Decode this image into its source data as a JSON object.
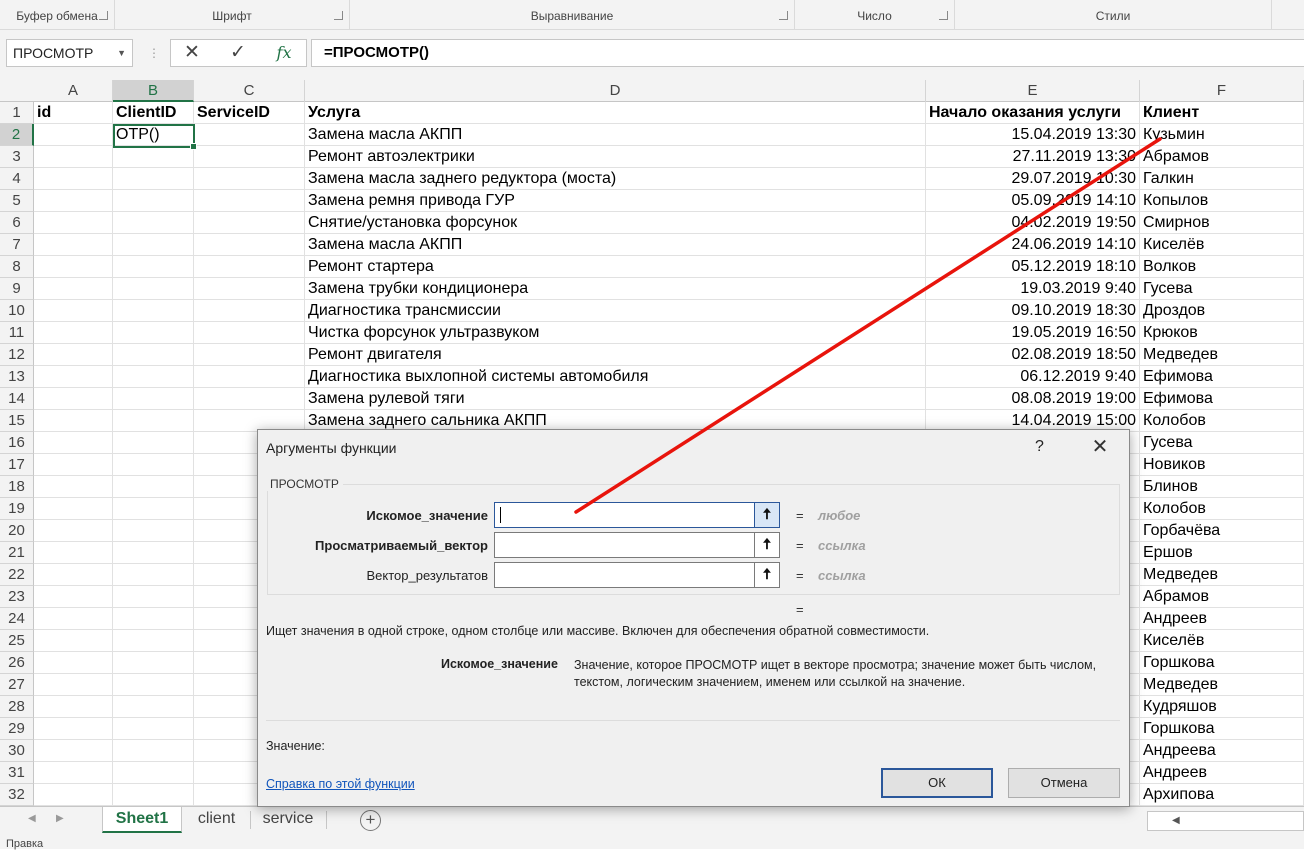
{
  "ribbon": {
    "groups": [
      "Буфер обмена",
      "Шрифт",
      "Выравнивание",
      "Число",
      "Стили"
    ]
  },
  "formula_bar": {
    "name_box": "ПРОСМОТР",
    "formula": "=ПРОСМОТР()",
    "fx": "fx"
  },
  "columns": [
    "A",
    "B",
    "C",
    "D",
    "E",
    "F"
  ],
  "header_row": [
    "id",
    "ClientID",
    "ServiceID",
    "Услуга",
    "Начало оказания услуги",
    "Клиент"
  ],
  "active_cell_value": "OTP()",
  "rows": [
    {
      "num": "1"
    },
    {
      "num": "2",
      "service": "Замена масла АКПП",
      "date": "15.04.2019 13:30",
      "client": "Кузьмин"
    },
    {
      "num": "3",
      "service": "Ремонт автоэлектрики",
      "date": "27.11.2019 13:30",
      "client": "Абрамов"
    },
    {
      "num": "4",
      "service": "Замена масла заднего редуктора (моста)",
      "date": "29.07.2019 10:30",
      "client": "Галкин"
    },
    {
      "num": "5",
      "service": "Замена ремня привода ГУР",
      "date": "05.09.2019 14:10",
      "client": "Копылов"
    },
    {
      "num": "6",
      "service": "Снятие/установка форсунок",
      "date": "04.02.2019 19:50",
      "client": "Смирнов"
    },
    {
      "num": "7",
      "service": "Замена масла АКПП",
      "date": "24.06.2019 14:10",
      "client": "Киселёв"
    },
    {
      "num": "8",
      "service": "Ремонт стартера",
      "date": "05.12.2019 18:10",
      "client": "Волков"
    },
    {
      "num": "9",
      "service": "Замена трубки кондиционера",
      "date": "19.03.2019 9:40",
      "client": "Гусева"
    },
    {
      "num": "10",
      "service": "Диагностика трансмиссии",
      "date": "09.10.2019 18:30",
      "client": "Дроздов"
    },
    {
      "num": "11",
      "service": "Чистка форсунок ультразвуком",
      "date": "19.05.2019 16:50",
      "client": "Крюков"
    },
    {
      "num": "12",
      "service": "Ремонт двигателя",
      "date": "02.08.2019 18:50",
      "client": "Медведев"
    },
    {
      "num": "13",
      "service": "Диагностика выхлопной системы автомобиля",
      "date": "06.12.2019 9:40",
      "client": "Ефимова"
    },
    {
      "num": "14",
      "service": "Замена рулевой тяги",
      "date": "08.08.2019 19:00",
      "client": "Ефимова"
    },
    {
      "num": "15",
      "service": "Замена заднего сальника АКПП",
      "date": "14.04.2019 15:00",
      "client": "Колобов"
    },
    {
      "num": "16",
      "client": "Гусева"
    },
    {
      "num": "17",
      "client": "Новиков"
    },
    {
      "num": "18",
      "client": "Блинов"
    },
    {
      "num": "19",
      "client": "Колобов"
    },
    {
      "num": "20",
      "client": "Горбачёва"
    },
    {
      "num": "21",
      "client": "Ершов"
    },
    {
      "num": "22",
      "client": "Медведев"
    },
    {
      "num": "23",
      "client": "Абрамов"
    },
    {
      "num": "24",
      "client": "Андреев"
    },
    {
      "num": "25",
      "client": "Киселёв"
    },
    {
      "num": "26",
      "client": "Горшкова"
    },
    {
      "num": "27",
      "client": "Медведев"
    },
    {
      "num": "28",
      "client": "Кудряшов"
    },
    {
      "num": "29",
      "client": "Горшкова"
    },
    {
      "num": "30",
      "client": "Андреева"
    },
    {
      "num": "31",
      "client": "Андреев"
    },
    {
      "num": "32",
      "client": "Архипова"
    }
  ],
  "sheet_tabs": [
    "Sheet1",
    "client",
    "service"
  ],
  "status_bar": "Правка",
  "dialog": {
    "title": "Аргументы функции",
    "help": "?",
    "close": "✕",
    "function_name": "ПРОСМОТР",
    "args": [
      {
        "label": "Искомое_значение",
        "value": "любое"
      },
      {
        "label": "Просматриваемый_вектор",
        "value": "ссылка"
      },
      {
        "label": "Вектор_результатов",
        "value": "ссылка"
      }
    ],
    "equals": "=",
    "description": "Ищет значения в одной строке, одном столбце или массиве. Включен для обеспечения обратной совместимости.",
    "arg_name": "Искомое_значение",
    "arg_description": "Значение, которое ПРОСМОТР ищет в векторе просмотра; значение может быть числом, текстом, логическим значением, именем или ссылкой на значение.",
    "value_label": "Значение:",
    "help_link": "Справка по этой функции",
    "ok": "ОК",
    "cancel": "Отмена"
  },
  "colors": {
    "accent": "#217346",
    "annotation": "#e8140c",
    "link": "#1155bb"
  }
}
